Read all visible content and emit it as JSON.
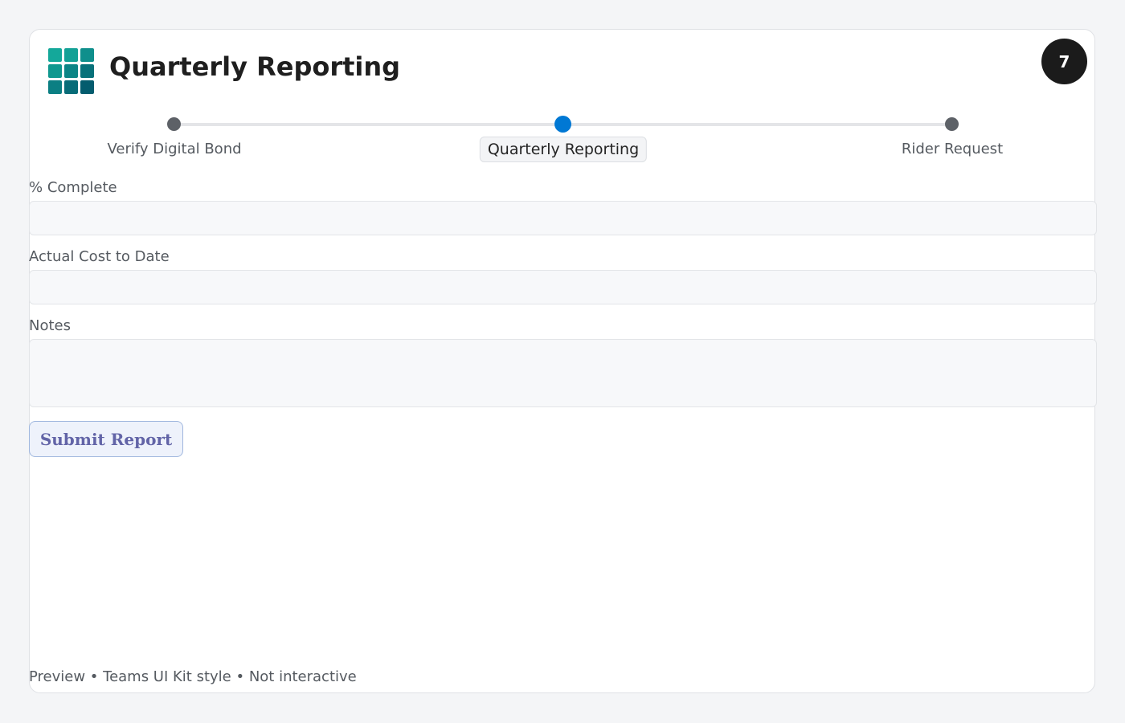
{
  "header": {
    "title": "Quarterly Reporting",
    "app_icon": "app-grid-icon",
    "badge_count": "7"
  },
  "stepper": {
    "steps": [
      {
        "label": "Verify Digital Bond",
        "state": "complete"
      },
      {
        "label": "Quarterly Reporting",
        "state": "current"
      },
      {
        "label": "Rider Request",
        "state": "upcoming"
      }
    ],
    "active_color": "#0078d4",
    "inactive_color": "#5d6167"
  },
  "form": {
    "percent_complete_label": "% Complete",
    "percent_complete_value": "",
    "actual_cost_label": "Actual Cost to Date",
    "actual_cost_value": "",
    "notes_label": "Notes",
    "notes_value": "",
    "submit_label": "Submit Report"
  },
  "footer": {
    "text": "Preview • Teams UI Kit style • Not interactive"
  },
  "colors": {
    "accent": "#6264a7",
    "icon_gradient_top": "#14a89a",
    "icon_gradient_bottom": "#045c6e"
  }
}
